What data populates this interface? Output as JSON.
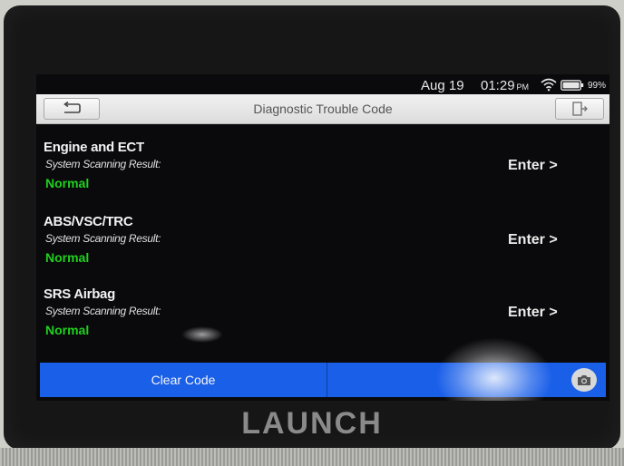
{
  "status_bar": {
    "date": "Aug 19",
    "time": "01:29",
    "ampm": "PM",
    "battery": "99%"
  },
  "title_bar": {
    "title": "Diagnostic Trouble Code"
  },
  "systems": [
    {
      "name": "Engine and ECT",
      "scan_label": "System Scanning Result:",
      "result": "Normal",
      "enter_label": "Enter >"
    },
    {
      "name": "ABS/VSC/TRC",
      "scan_label": "System Scanning Result:",
      "result": "Normal",
      "enter_label": "Enter >"
    },
    {
      "name": "SRS Airbag",
      "scan_label": "System Scanning Result:",
      "result": "Normal",
      "enter_label": "Enter >"
    }
  ],
  "bottom_bar": {
    "clear_code_label": "Clear Code"
  },
  "device": {
    "brand": "LAUNCH"
  },
  "icons": {
    "back": "back-arrow-icon",
    "exit": "exit-icon",
    "wifi": "wifi-icon",
    "battery": "battery-icon",
    "camera": "camera-icon"
  },
  "colors": {
    "accent_blue": "#1a5fe8",
    "result_green": "#1fd11f"
  }
}
